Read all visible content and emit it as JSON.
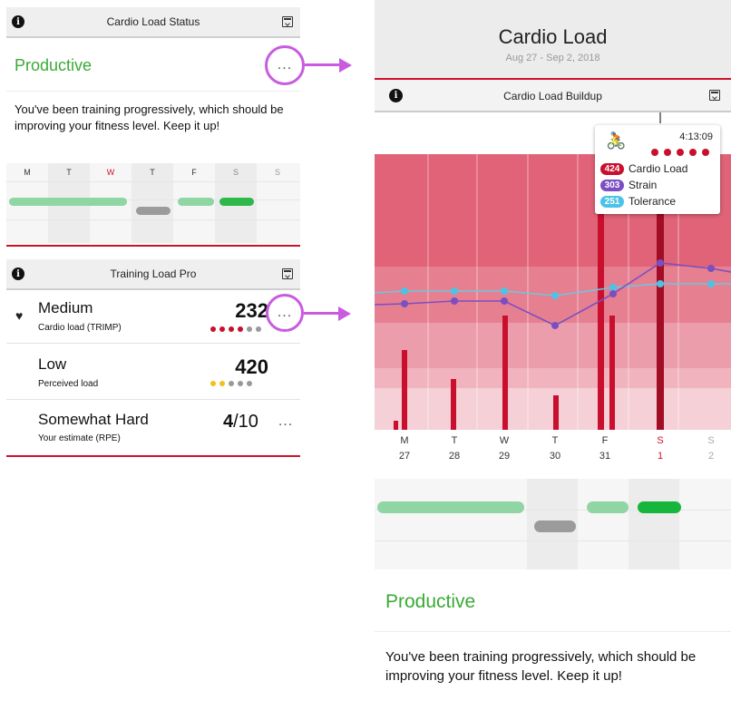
{
  "left": {
    "status_card": {
      "title": "Cardio Load Status",
      "status": "Productive",
      "more": "...",
      "description": "You've been training progressively, which should be improving your fitness level. Keep it up!",
      "days": [
        "M",
        "T",
        "W",
        "T",
        "F",
        "S",
        "S"
      ]
    },
    "training_card": {
      "title": "Training Load Pro",
      "rows": [
        {
          "level": "Medium",
          "sub": "Cardio load (TRIMP)",
          "value": "232",
          "more": "..."
        },
        {
          "level": "Low",
          "sub": "Perceived load",
          "value": "420"
        },
        {
          "level": "Somewhat Hard",
          "sub": "Your estimate (RPE)",
          "value_main": "4",
          "value_suffix": "/10",
          "more": "..."
        }
      ]
    }
  },
  "right": {
    "title": "Cardio Load",
    "date_range": "Aug 27 - Sep 2, 2018",
    "chart_title": "Cardio Load Buildup",
    "tooltip": {
      "time": "4:13:09",
      "items": [
        {
          "value": "424",
          "label": "Cardio Load",
          "color": "#c8102e"
        },
        {
          "value": "303",
          "label": "Strain",
          "color": "#7b4fc2"
        },
        {
          "value": "251",
          "label": "Tolerance",
          "color": "#4cc3e6"
        }
      ]
    },
    "day_letters": [
      "M",
      "T",
      "W",
      "T",
      "F",
      "S",
      "S"
    ],
    "day_numbers": [
      "27",
      "28",
      "29",
      "30",
      "31",
      "1",
      "2"
    ],
    "status": "Productive",
    "description": "You've been training progressively, which should be improving your fitness level. Keep it up!"
  },
  "colors": {
    "accent_red": "#d0102a",
    "productive_green": "#3aaa35",
    "highlight_purple": "#c95be0",
    "weekend_red": "#d0102a"
  },
  "chart_data": {
    "type": "bar",
    "title": "Cardio Load Buildup",
    "categories": [
      "M 27",
      "T 28",
      "W 29",
      "T 30",
      "F 31",
      "S 1",
      "S 2"
    ],
    "series": [
      {
        "name": "Cardio Load",
        "values": [
          [
            8,
            80
          ],
          [
            60
          ],
          [
            130
          ],
          [
            40
          ],
          [
            424,
            140
          ],
          [
            424
          ],
          [
            0
          ]
        ]
      },
      {
        "name": "Strain",
        "values": [
          148,
          152,
          151,
          118,
          160,
          205,
          193
        ]
      },
      {
        "name": "Tolerance",
        "values": [
          168,
          172,
          171,
          165,
          175,
          180,
          180
        ]
      }
    ]
  }
}
